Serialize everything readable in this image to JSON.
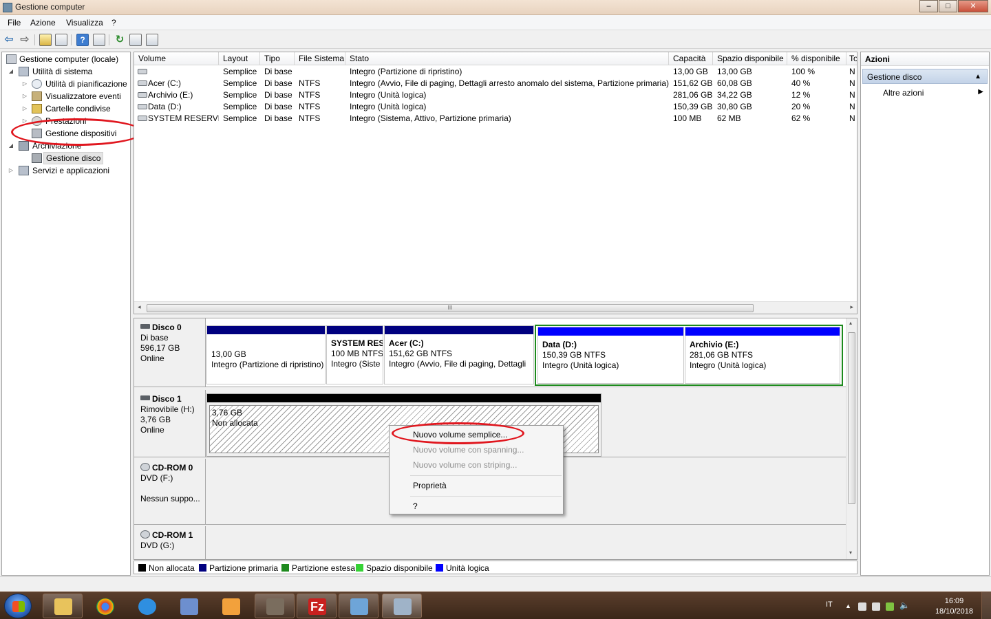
{
  "window": {
    "title": "Gestione computer",
    "min": "–",
    "max": "□",
    "close": "✕"
  },
  "menu": [
    "File",
    "Azione",
    "Visualizza",
    "?"
  ],
  "tree": {
    "root": "Gestione computer (locale)",
    "system_tools": "Utilità di sistema",
    "task_scheduler": "Utilità di pianificazione",
    "event_viewer": "Visualizzatore eventi",
    "shared_folders": "Cartelle condivise",
    "performance": "Prestazioni",
    "device_manager": "Gestione dispositivi",
    "storage": "Archiviazione",
    "disk_management": "Gestione disco",
    "services": "Servizi e applicazioni"
  },
  "volumes": {
    "columns": [
      "Volume",
      "Layout",
      "Tipo",
      "File Sistema",
      "Stato",
      "Capacità",
      "Spazio disponibile",
      "% disponibile",
      "To"
    ],
    "rows": [
      {
        "volume": "",
        "layout": "Semplice",
        "tipo": "Di base",
        "fs": "",
        "stato": "Integro (Partizione di ripristino)",
        "cap": "13,00 GB",
        "free": "13,00 GB",
        "pct": "100 %",
        "to": "N"
      },
      {
        "volume": "Acer (C:)",
        "layout": "Semplice",
        "tipo": "Di base",
        "fs": "NTFS",
        "stato": "Integro (Avvio, File di paging, Dettagli arresto anomalo del sistema, Partizione primaria)",
        "cap": "151,62 GB",
        "free": "60,08 GB",
        "pct": "40 %",
        "to": "N"
      },
      {
        "volume": "Archivio (E:)",
        "layout": "Semplice",
        "tipo": "Di base",
        "fs": "NTFS",
        "stato": "Integro (Unità logica)",
        "cap": "281,06 GB",
        "free": "34,22 GB",
        "pct": "12 %",
        "to": "N"
      },
      {
        "volume": "Data (D:)",
        "layout": "Semplice",
        "tipo": "Di base",
        "fs": "NTFS",
        "stato": "Integro (Unità logica)",
        "cap": "150,39 GB",
        "free": "30,80 GB",
        "pct": "20 %",
        "to": "N"
      },
      {
        "volume": "SYSTEM RESERVED",
        "layout": "Semplice",
        "tipo": "Di base",
        "fs": "NTFS",
        "stato": "Integro (Sistema, Attivo, Partizione primaria)",
        "cap": "100 MB",
        "free": "62 MB",
        "pct": "62 %",
        "to": "N"
      }
    ],
    "scroll_grip": "III"
  },
  "disks": {
    "disk0": {
      "name": "Disco 0",
      "type": "Di base",
      "size": "596,17 GB",
      "status": "Online",
      "parts": [
        {
          "title": "",
          "size": "13,00 GB",
          "status": "Integro (Partizione di ripristino)"
        },
        {
          "title": "SYSTEM RES",
          "size": "100 MB NTFS",
          "status": "Integro (Siste"
        },
        {
          "title": "Acer  (C:)",
          "size": "151,62 GB NTFS",
          "status": "Integro (Avvio, File di paging, Dettagli"
        },
        {
          "title": "Data  (D:)",
          "size": "150,39 GB NTFS",
          "status": "Integro (Unità logica)"
        },
        {
          "title": "Archivio  (E:)",
          "size": "281,06 GB NTFS",
          "status": "Integro (Unità logica)"
        }
      ]
    },
    "disk1": {
      "name": "Disco 1",
      "type": "Rimovibile (H:)",
      "size": "3,76 GB",
      "status": "Online",
      "part_size": "3,76 GB",
      "part_status": "Non allocata"
    },
    "cd0": {
      "name": "CD-ROM 0",
      "type": "DVD (F:)",
      "status": "Nessun suppo..."
    },
    "cd1": {
      "name": "CD-ROM 1",
      "type": "DVD (G:)"
    }
  },
  "legend": [
    {
      "label": "Non allocata",
      "color": "#000000"
    },
    {
      "label": "Partizione primaria",
      "color": "#00007f"
    },
    {
      "label": "Partizione estesa",
      "color": "#1e8a1e"
    },
    {
      "label": "Spazio disponibile",
      "color": "#35d235"
    },
    {
      "label": "Unità logica",
      "color": "#0000ff"
    }
  ],
  "actions": {
    "header": "Azioni",
    "section": "Gestione disco",
    "more": "Altre azioni"
  },
  "context_menu": {
    "new_simple": "Nuovo volume semplice...",
    "new_spanned": "Nuovo volume con spanning...",
    "new_striped": "Nuovo volume con striping...",
    "properties": "Proprietà",
    "help": "?"
  },
  "taskbar": {
    "lang": "IT",
    "time": "16:09",
    "date": "18/10/2018"
  }
}
